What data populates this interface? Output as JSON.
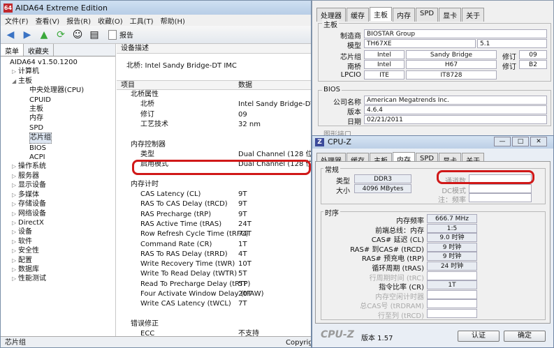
{
  "aida": {
    "title": "AIDA64 Extreme Edition",
    "menu": [
      "文件(F)",
      "查看(V)",
      "报告(R)",
      "收藏(O)",
      "工具(T)",
      "帮助(H)"
    ],
    "toolbar": {
      "report_label": "报告"
    },
    "left_tabs": [
      "菜单",
      "收藏夹"
    ],
    "tree": [
      {
        "label": "AIDA64 v1.50.1200",
        "level": 0,
        "expander": ""
      },
      {
        "label": "计算机",
        "level": 1,
        "expander": "▷"
      },
      {
        "label": "主板",
        "level": 1,
        "expander": "◢"
      },
      {
        "label": "中央处理器(CPU)",
        "level": 2,
        "expander": ""
      },
      {
        "label": "CPUID",
        "level": 2,
        "expander": ""
      },
      {
        "label": "主板",
        "level": 2,
        "expander": ""
      },
      {
        "label": "内存",
        "level": 2,
        "expander": ""
      },
      {
        "label": "SPD",
        "level": 2,
        "expander": ""
      },
      {
        "label": "芯片组",
        "level": 2,
        "expander": "",
        "selected": true
      },
      {
        "label": "BIOS",
        "level": 2,
        "expander": ""
      },
      {
        "label": "ACPI",
        "level": 2,
        "expander": ""
      },
      {
        "label": "操作系统",
        "level": 1,
        "expander": "▷"
      },
      {
        "label": "服务器",
        "level": 1,
        "expander": "▷"
      },
      {
        "label": "显示设备",
        "level": 1,
        "expander": "▷"
      },
      {
        "label": "多媒体",
        "level": 1,
        "expander": "▷"
      },
      {
        "label": "存储设备",
        "level": 1,
        "expander": "▷"
      },
      {
        "label": "网络设备",
        "level": 1,
        "expander": "▷"
      },
      {
        "label": "DirectX",
        "level": 1,
        "expander": "▷"
      },
      {
        "label": "设备",
        "level": 1,
        "expander": "▷"
      },
      {
        "label": "软件",
        "level": 1,
        "expander": "▷"
      },
      {
        "label": "安全性",
        "level": 1,
        "expander": "▷"
      },
      {
        "label": "配置",
        "level": 1,
        "expander": "▷"
      },
      {
        "label": "数据库",
        "level": 1,
        "expander": "▷"
      },
      {
        "label": "性能测试",
        "level": 1,
        "expander": "▷"
      }
    ],
    "device_desc_header": "设备描述",
    "device_desc_value": "北桥: Intel Sandy Bridge-DT IMC",
    "col_item": "项目",
    "col_data": "数据",
    "rows": [
      {
        "k": "北桥属性",
        "v": "",
        "sec": true
      },
      {
        "k": "北桥",
        "v": "Intel Sandy Bridge-DT IMC"
      },
      {
        "k": "修订",
        "v": "09"
      },
      {
        "k": "工艺技术",
        "v": "32 nm"
      },
      {
        "k": "",
        "v": ""
      },
      {
        "k": "内存控制器",
        "v": "",
        "sec": true
      },
      {
        "k": "类型",
        "v": "Dual Channel  (128 位)"
      },
      {
        "k": "启用模式",
        "v": "Dual Channel  (128 位)"
      },
      {
        "k": "",
        "v": ""
      },
      {
        "k": "内存计时",
        "v": "",
        "sec": true
      },
      {
        "k": "CAS Latency (CL)",
        "v": "9T"
      },
      {
        "k": "RAS To CAS Delay (tRCD)",
        "v": "9T"
      },
      {
        "k": "RAS Precharge (tRP)",
        "v": "9T"
      },
      {
        "k": "RAS Active Time (tRAS)",
        "v": "24T"
      },
      {
        "k": "Row Refresh Cycle Time (tRFC)",
        "v": "74T"
      },
      {
        "k": "Command Rate (CR)",
        "v": "1T"
      },
      {
        "k": "RAS To RAS Delay (tRRD)",
        "v": "4T"
      },
      {
        "k": "Write Recovery Time (tWR)",
        "v": "10T"
      },
      {
        "k": "Write To Read Delay (tWTR)",
        "v": "5T"
      },
      {
        "k": "Read To Precharge Delay (tRTP)",
        "v": "5T"
      },
      {
        "k": "Four Activate Window Delay (tFAW)",
        "v": "20T"
      },
      {
        "k": "Write CAS Latency (tWCL)",
        "v": "7T"
      },
      {
        "k": "",
        "v": ""
      },
      {
        "k": "错误修正",
        "v": "",
        "sec": true
      },
      {
        "k": "ECC",
        "v": "不支持"
      }
    ],
    "status_left": "芯片组",
    "status_right": "Copyrig"
  },
  "cpuz_back": {
    "tabs": [
      "处理器",
      "缓存",
      "主板",
      "内存",
      "SPD",
      "显卡",
      "关于"
    ],
    "active_tab": 2,
    "group_mainboard": "主板",
    "manufacturer_label": "制造商",
    "manufacturer": "BIOSTAR Group",
    "model_label": "模型",
    "model": "TH67XE",
    "model_rev": "5.1",
    "chipset_label": "芯片组",
    "chipset_vendor": "Intel",
    "chipset_name": "Sandy Bridge",
    "rev_label": "修订",
    "chipset_rev": "09",
    "southbridge_label": "南桥",
    "sb_vendor": "Intel",
    "sb_name": "H67",
    "sb_rev": "B2",
    "lpcio_label": "LPCIO",
    "lpcio_vendor": "ITE",
    "lpcio_name": "IT8728",
    "group_bios": "BIOS",
    "bios_brand_label": "公司名称",
    "bios_brand": "American Megatrends Inc.",
    "bios_version_label": "版本",
    "bios_version": "4.6.4",
    "bios_date_label": "日期",
    "bios_date": "02/21/2011",
    "group_graphic": "图形接口"
  },
  "cpuz_front": {
    "title": "CPU-Z",
    "tabs": [
      "处理器",
      "缓存",
      "主板",
      "内存",
      "SPD",
      "显卡",
      "关于"
    ],
    "active_tab": 3,
    "group_general": "常规",
    "type_label": "类型",
    "type": "DDR3",
    "channel_label": "通道数",
    "size_label": "大小",
    "size": "4096 MBytes",
    "dc_mode_label": "DC模式",
    "nb_freq_label": "注：频率",
    "group_timings": "时序",
    "timings": [
      {
        "label": "内存频率",
        "value": "666.7 MHz",
        "enabled": true
      },
      {
        "label": "前端总线：内存",
        "value": "1:5",
        "enabled": true
      },
      {
        "label": "CAS# 延迟 (CL)",
        "value": "9.0 时钟",
        "enabled": true
      },
      {
        "label": "RAS# 到CAS# (tRCD)",
        "value": "9 时钟",
        "enabled": true
      },
      {
        "label": "RAS# 预充电 (tRP)",
        "value": "9 时钟",
        "enabled": true
      },
      {
        "label": "循环周期 (tRAS)",
        "value": "24 时钟",
        "enabled": true
      },
      {
        "label": "行周期时间 (tRC)",
        "value": "",
        "enabled": false
      },
      {
        "label": "指令比率 (CR)",
        "value": "1T",
        "enabled": true
      },
      {
        "label": "内存空闲计时器",
        "value": "",
        "enabled": false
      },
      {
        "label": "总CAS号 (tRDRAM)",
        "value": "",
        "enabled": false
      },
      {
        "label": "行至列 (tRCD)",
        "value": "",
        "enabled": false
      }
    ],
    "brand": "CPU-Z",
    "version": "版本 1.57",
    "validate_label": "认证",
    "ok_label": "确定",
    "min_btn": "—",
    "max_btn": "□",
    "close_btn": "✕"
  }
}
